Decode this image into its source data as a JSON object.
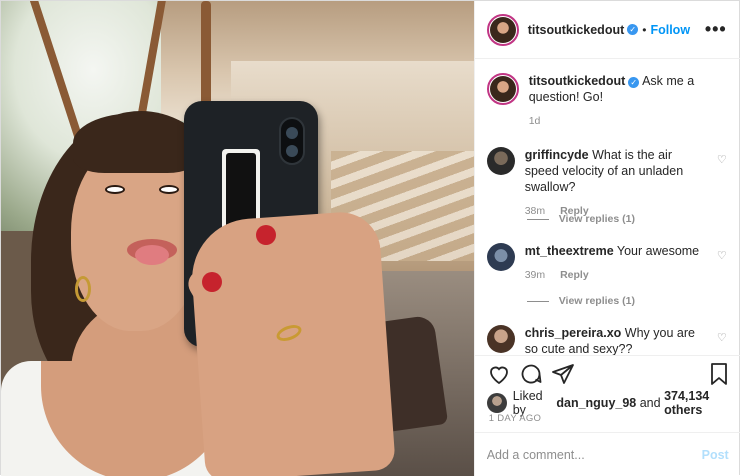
{
  "post": {
    "author": "titsoutkickedout",
    "follow_label": "Follow",
    "dot": "•",
    "more_label": "•••"
  },
  "caption": {
    "username": "titsoutkickedout",
    "text": "Ask me a question! Go!",
    "age": "1d"
  },
  "comments": [
    {
      "username": "griffincyde",
      "text": "What is the air speed velocity of an unladen swallow?",
      "age": "38m",
      "reply_label": "Reply",
      "view_replies": "View replies (1)"
    },
    {
      "username": "mt_theextreme",
      "text": "Your awesome",
      "age": "39m",
      "reply_label": "Reply",
      "view_replies": "View replies (1)"
    },
    {
      "username": "chris_pereira.xo",
      "text": "Why you are so cute and sexy?? AaaHhhhh!!!!!"
    }
  ],
  "likes": {
    "prefix": "Liked by",
    "user": "dan_nguy_98",
    "joiner": "and",
    "count": "374,134 others"
  },
  "date": "1 DAY AGO",
  "add_comment": {
    "placeholder": "Add a comment...",
    "post_label": "Post"
  },
  "colors": {
    "accent": "#0095f6",
    "verified": "#3897f0",
    "nail": "#c6232d"
  }
}
